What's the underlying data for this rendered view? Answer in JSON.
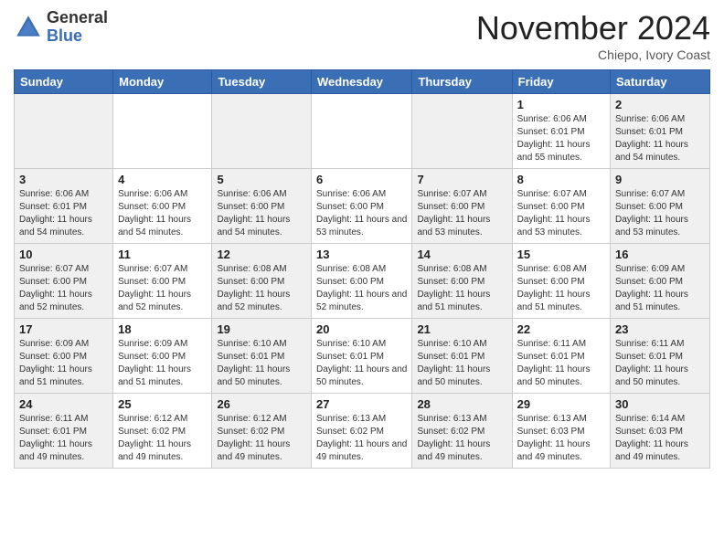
{
  "header": {
    "logo_general": "General",
    "logo_blue": "Blue",
    "month_title": "November 2024",
    "location": "Chiepo, Ivory Coast"
  },
  "days_of_week": [
    "Sunday",
    "Monday",
    "Tuesday",
    "Wednesday",
    "Thursday",
    "Friday",
    "Saturday"
  ],
  "weeks": [
    [
      {
        "day": "",
        "info": ""
      },
      {
        "day": "",
        "info": ""
      },
      {
        "day": "",
        "info": ""
      },
      {
        "day": "",
        "info": ""
      },
      {
        "day": "",
        "info": ""
      },
      {
        "day": "1",
        "info": "Sunrise: 6:06 AM\nSunset: 6:01 PM\nDaylight: 11 hours\nand 55 minutes."
      },
      {
        "day": "2",
        "info": "Sunrise: 6:06 AM\nSunset: 6:01 PM\nDaylight: 11 hours\nand 54 minutes."
      }
    ],
    [
      {
        "day": "3",
        "info": "Sunrise: 6:06 AM\nSunset: 6:01 PM\nDaylight: 11 hours\nand 54 minutes."
      },
      {
        "day": "4",
        "info": "Sunrise: 6:06 AM\nSunset: 6:00 PM\nDaylight: 11 hours\nand 54 minutes."
      },
      {
        "day": "5",
        "info": "Sunrise: 6:06 AM\nSunset: 6:00 PM\nDaylight: 11 hours\nand 54 minutes."
      },
      {
        "day": "6",
        "info": "Sunrise: 6:06 AM\nSunset: 6:00 PM\nDaylight: 11 hours\nand 53 minutes."
      },
      {
        "day": "7",
        "info": "Sunrise: 6:07 AM\nSunset: 6:00 PM\nDaylight: 11 hours\nand 53 minutes."
      },
      {
        "day": "8",
        "info": "Sunrise: 6:07 AM\nSunset: 6:00 PM\nDaylight: 11 hours\nand 53 minutes."
      },
      {
        "day": "9",
        "info": "Sunrise: 6:07 AM\nSunset: 6:00 PM\nDaylight: 11 hours\nand 53 minutes."
      }
    ],
    [
      {
        "day": "10",
        "info": "Sunrise: 6:07 AM\nSunset: 6:00 PM\nDaylight: 11 hours\nand 52 minutes."
      },
      {
        "day": "11",
        "info": "Sunrise: 6:07 AM\nSunset: 6:00 PM\nDaylight: 11 hours\nand 52 minutes."
      },
      {
        "day": "12",
        "info": "Sunrise: 6:08 AM\nSunset: 6:00 PM\nDaylight: 11 hours\nand 52 minutes."
      },
      {
        "day": "13",
        "info": "Sunrise: 6:08 AM\nSunset: 6:00 PM\nDaylight: 11 hours\nand 52 minutes."
      },
      {
        "day": "14",
        "info": "Sunrise: 6:08 AM\nSunset: 6:00 PM\nDaylight: 11 hours\nand 51 minutes."
      },
      {
        "day": "15",
        "info": "Sunrise: 6:08 AM\nSunset: 6:00 PM\nDaylight: 11 hours\nand 51 minutes."
      },
      {
        "day": "16",
        "info": "Sunrise: 6:09 AM\nSunset: 6:00 PM\nDaylight: 11 hours\nand 51 minutes."
      }
    ],
    [
      {
        "day": "17",
        "info": "Sunrise: 6:09 AM\nSunset: 6:00 PM\nDaylight: 11 hours\nand 51 minutes."
      },
      {
        "day": "18",
        "info": "Sunrise: 6:09 AM\nSunset: 6:00 PM\nDaylight: 11 hours\nand 51 minutes."
      },
      {
        "day": "19",
        "info": "Sunrise: 6:10 AM\nSunset: 6:01 PM\nDaylight: 11 hours\nand 50 minutes."
      },
      {
        "day": "20",
        "info": "Sunrise: 6:10 AM\nSunset: 6:01 PM\nDaylight: 11 hours\nand 50 minutes."
      },
      {
        "day": "21",
        "info": "Sunrise: 6:10 AM\nSunset: 6:01 PM\nDaylight: 11 hours\nand 50 minutes."
      },
      {
        "day": "22",
        "info": "Sunrise: 6:11 AM\nSunset: 6:01 PM\nDaylight: 11 hours\nand 50 minutes."
      },
      {
        "day": "23",
        "info": "Sunrise: 6:11 AM\nSunset: 6:01 PM\nDaylight: 11 hours\nand 50 minutes."
      }
    ],
    [
      {
        "day": "24",
        "info": "Sunrise: 6:11 AM\nSunset: 6:01 PM\nDaylight: 11 hours\nand 49 minutes."
      },
      {
        "day": "25",
        "info": "Sunrise: 6:12 AM\nSunset: 6:02 PM\nDaylight: 11 hours\nand 49 minutes."
      },
      {
        "day": "26",
        "info": "Sunrise: 6:12 AM\nSunset: 6:02 PM\nDaylight: 11 hours\nand 49 minutes."
      },
      {
        "day": "27",
        "info": "Sunrise: 6:13 AM\nSunset: 6:02 PM\nDaylight: 11 hours\nand 49 minutes."
      },
      {
        "day": "28",
        "info": "Sunrise: 6:13 AM\nSunset: 6:02 PM\nDaylight: 11 hours\nand 49 minutes."
      },
      {
        "day": "29",
        "info": "Sunrise: 6:13 AM\nSunset: 6:03 PM\nDaylight: 11 hours\nand 49 minutes."
      },
      {
        "day": "30",
        "info": "Sunrise: 6:14 AM\nSunset: 6:03 PM\nDaylight: 11 hours\nand 49 minutes."
      }
    ]
  ]
}
